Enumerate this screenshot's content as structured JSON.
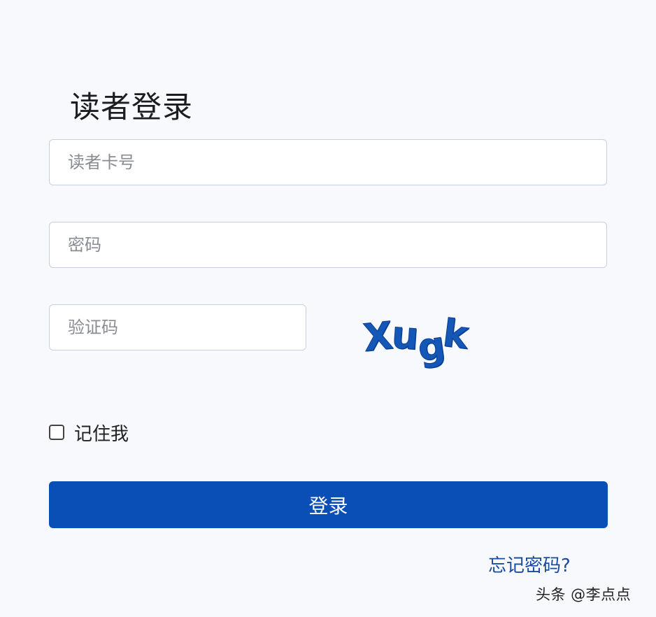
{
  "login": {
    "title": "读者登录",
    "card_number_placeholder": "读者卡号",
    "password_placeholder": "密码",
    "captcha_placeholder": "验证码",
    "captcha_chars": [
      "X",
      "u",
      "g",
      "k"
    ],
    "remember_label": "记住我",
    "remember_checked": false,
    "login_button_label": "登录",
    "forgot_password_link": "忘记密码?"
  },
  "watermark": "头条 @李点点",
  "colors": {
    "primary": "#0a4fb5",
    "link": "#1a4aa3",
    "captcha": "#1457b7",
    "background": "#f7f9fc"
  }
}
